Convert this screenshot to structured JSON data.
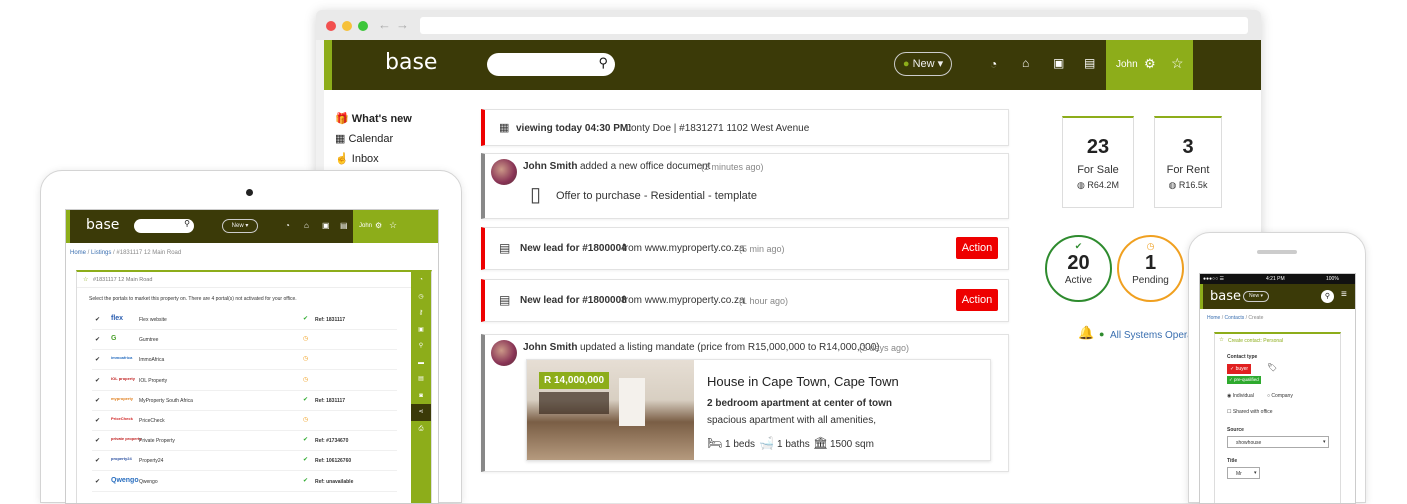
{
  "browser": {
    "app": {
      "logo": "base",
      "new_label": "New ▾",
      "user_name": "John",
      "sidebar": [
        {
          "icon": "gift-icon",
          "label": "What's new",
          "bold": true
        },
        {
          "icon": "calendar-icon",
          "label": "Calendar"
        },
        {
          "icon": "hand-icon",
          "label": "Inbox"
        }
      ],
      "feed": {
        "viewing": {
          "prefix": "viewing today 04:30 PM:",
          "text": "Jonty Doe | #1831271 1102 West Avenue"
        },
        "doc": {
          "author": "John Smith",
          "text": "added a new office document",
          "time": "(2 minutes ago)",
          "doc_name": "Offer to purchase - Residential - template"
        },
        "leads": [
          {
            "title": "New lead for #1800004",
            "from": "from www.myproperty.co.za",
            "time": "(5 min ago)",
            "action": "Action"
          },
          {
            "title": "New lead for #1800008",
            "from": "from www.myproperty.co.za",
            "time": "(1 hour ago)",
            "action": "Action"
          }
        ],
        "mandate": {
          "author": "John Smith",
          "text": "updated a listing mandate (price from R15,000,000 to R14,000,000)",
          "time": "(2 days ago)",
          "price_badge": "R 14,000,000",
          "listing_title": "House in Cape Town, Cape Town",
          "listing_subtitle": "2 bedroom apartment at center of town",
          "listing_desc": "spacious apartment with all amenities,",
          "beds": "1 beds",
          "baths": "1 baths",
          "size": "1500 sqm"
        }
      },
      "stats": [
        {
          "number": "23",
          "label": "For Sale",
          "value": "R64.2M"
        },
        {
          "number": "3",
          "label": "For Rent",
          "value": "R16.5k"
        }
      ],
      "circles": [
        {
          "number": "20",
          "label": "Active",
          "color": "#2e8b2e"
        },
        {
          "number": "1",
          "label": "Pending",
          "color": "#f0a020"
        }
      ],
      "status_text": "All Systems Operational"
    }
  },
  "tablet": {
    "logo": "base",
    "new_label": "New ▾",
    "user_name": "John",
    "breadcrumb": [
      "Home",
      "Listings",
      "#1831117 12 Main Road"
    ],
    "panel_title": "#1831117 12 Main Road",
    "intro": "Select the portals to market this property on. There are 4 portal(s) not activated for your office.",
    "portals": [
      {
        "logo": "flex",
        "name": "Flex website",
        "status": "ok",
        "ref": "Ref: 1831117"
      },
      {
        "logo": "G",
        "name": "Gumtree",
        "status": "pending",
        "ref": ""
      },
      {
        "logo": "immoafrica",
        "name": "ImmoAfrica",
        "status": "pending",
        "ref": ""
      },
      {
        "logo": "IOL property",
        "name": "IOL Property",
        "status": "pending",
        "ref": ""
      },
      {
        "logo": "myproperty",
        "name": "MyProperty South Africa",
        "status": "ok",
        "ref": "Ref: 1831117"
      },
      {
        "logo": "PriceCheck",
        "name": "PriceCheck",
        "status": "pending",
        "ref": ""
      },
      {
        "logo": "private property",
        "name": "Private Property",
        "status": "ok",
        "ref": "Ref: #1734670"
      },
      {
        "logo": "property24",
        "name": "Property24",
        "status": "ok",
        "ref": "Ref: 106126760"
      },
      {
        "logo": "Qwengo",
        "name": "Qwengo",
        "status": "ok",
        "ref": "Ref: unavailable"
      }
    ]
  },
  "phone": {
    "carrier": "●●●○○ ☰",
    "time": "4:21 PM",
    "battery": "100%",
    "logo": "base",
    "new_label": "New ▾",
    "breadcrumb": [
      "Home",
      "Contacts",
      "Create"
    ],
    "panel_title": "Create contact: Personal",
    "contact_type_label": "Contact type",
    "buyer_tag": "buyer",
    "prequal_tag": "pre-qualified",
    "radio_individual": "Individual",
    "radio_company": "Company",
    "shared_label": "Shared with office",
    "source_label": "Source",
    "source_value": "showhouse",
    "title_label": "Title",
    "title_value": "Mr"
  }
}
